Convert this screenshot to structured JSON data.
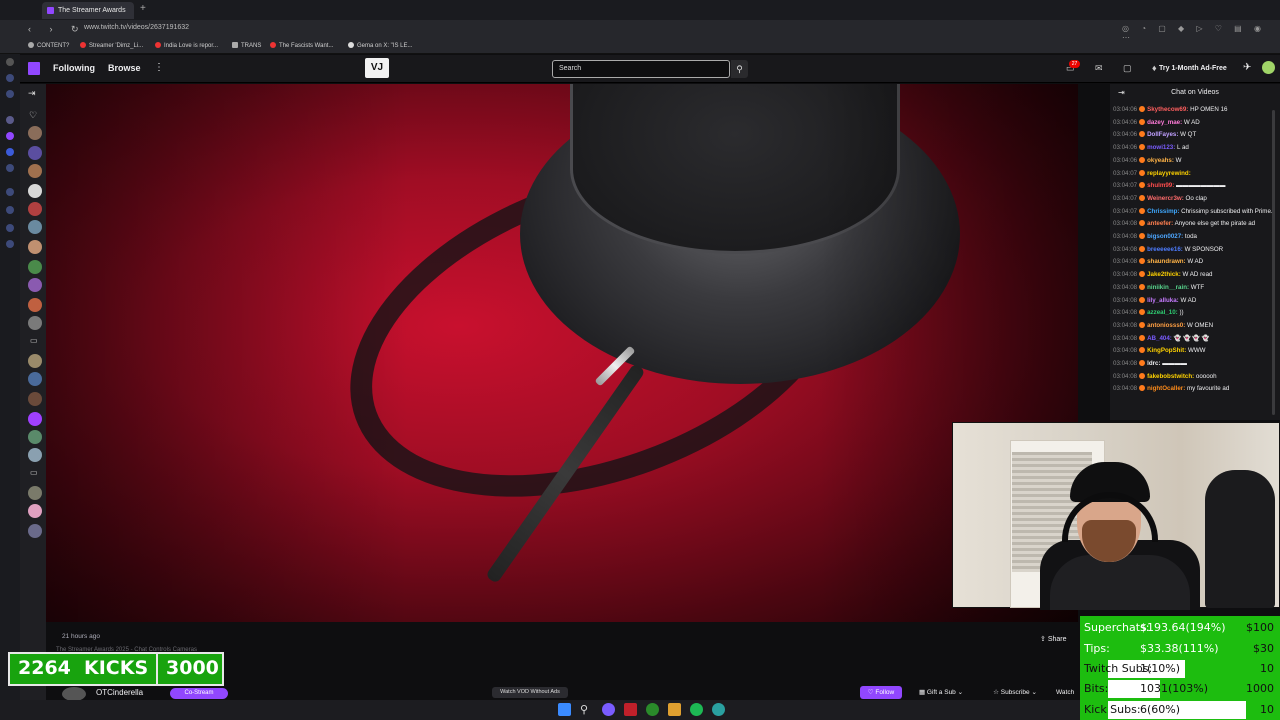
{
  "browser": {
    "tab_title": "The Streamer Awards",
    "new_tab": "+",
    "url": "www.twitch.tv/videos/2637191632",
    "bookmarks": [
      "CONTENT?",
      "Streamer 'Dimz_Li...",
      "India Love is repor...",
      "TRANS",
      "The Fascists Want...",
      "Gema on X: \"IS LE..."
    ]
  },
  "topnav": {
    "following": "Following",
    "browse": "Browse",
    "more": "⋮",
    "logo_text": "VJ",
    "search_placeholder": "Search",
    "notif_count": "27",
    "try_ad_free": "Try 1-Month Ad-Free"
  },
  "chat": {
    "title": "Chat on Videos",
    "messages": [
      {
        "time": "03:04:06",
        "user": "Skythecow69:",
        "text": "HP OMEN 16",
        "color": "#ff5f5f"
      },
      {
        "time": "03:04:06",
        "user": "dazey_mae:",
        "text": "W AD",
        "color": "#ff7ad9"
      },
      {
        "time": "03:04:06",
        "user": "DollFayes:",
        "text": "W QT",
        "color": "#c0a0ff"
      },
      {
        "time": "03:04:06",
        "user": "mowi123:",
        "text": "L ad",
        "color": "#7a5cff"
      },
      {
        "time": "03:04:06",
        "user": "okyeahs:",
        "text": "W",
        "color": "#ffb347"
      },
      {
        "time": "03:04:07",
        "user": "replayyrewind:",
        "text": "",
        "color": "#ffd200"
      },
      {
        "time": "03:04:07",
        "user": "shulm99:",
        "text": "▬▬▬▬▬▬▬▬",
        "color": "#ff4d4d"
      },
      {
        "time": "03:04:07",
        "user": "Weinercr3w:",
        "text": "Oo clap",
        "color": "#ff6b6b"
      },
      {
        "time": "03:04:07",
        "user": "Chrissimp:",
        "text": "Chrissimp subscribed with Prime.",
        "color": "#3fa9ff"
      },
      {
        "time": "03:04:08",
        "user": "anteefer:",
        "text": "Anyone else get the pirate ad",
        "color": "#ff7f50"
      },
      {
        "time": "03:04:08",
        "user": "bigson0027:",
        "text": "toda",
        "color": "#4da6ff"
      },
      {
        "time": "03:04:08",
        "user": "breeeeee16:",
        "text": "W SPONSOR",
        "color": "#4d7cff"
      },
      {
        "time": "03:04:08",
        "user": "shaundrawn:",
        "text": "W AD",
        "color": "#ffb347"
      },
      {
        "time": "03:04:08",
        "user": "Jake2thick:",
        "text": "W AD read",
        "color": "#ffd200"
      },
      {
        "time": "03:04:08",
        "user": "niniikin__rain:",
        "text": "WTF",
        "color": "#58d68d"
      },
      {
        "time": "03:04:08",
        "user": "lily_alluka:",
        "text": "W AD",
        "color": "#c67bff"
      },
      {
        "time": "03:04:08",
        "user": "azzeal_10:",
        "text": "))",
        "color": "#2ecc71"
      },
      {
        "time": "03:04:08",
        "user": "antoniosss0:",
        "text": "W OMEN",
        "color": "#ff9f43"
      },
      {
        "time": "03:04:08",
        "user": "AB_404:",
        "text": "👻 👻 👻 👻",
        "color": "#7a5cff"
      },
      {
        "time": "03:04:08",
        "user": "KingPopShit:",
        "text": "WWW",
        "color": "#ffd200"
      },
      {
        "time": "03:04:08",
        "user": "ldrc:",
        "text": "▬▬▬▬",
        "color": "#efeff1"
      },
      {
        "time": "03:04:08",
        "user": "fakebobstwitch:",
        "text": "oooooh",
        "color": "#ffd200"
      },
      {
        "time": "03:04:08",
        "user": "nightOcaller:",
        "text": "my favourite ad",
        "color": "#ff8c1a"
      }
    ]
  },
  "video": {
    "time_ago": "21 hours ago",
    "title": "The Streamer Awards 2025 - Chat Controls Cameras",
    "share": "Share"
  },
  "channel": {
    "name": "OTCinderella",
    "costream": "Co-Stream",
    "watch_without_ads": "Watch VOD Without Ads",
    "follow": "Follow",
    "gift_sub": "Gift a Sub",
    "subscribe": "Subscribe",
    "watch": "Watch"
  },
  "kicks": {
    "count": "2264",
    "label": "KICKS",
    "goal": "3000"
  },
  "goals": [
    {
      "label": "Superchats:",
      "value": "$193.64(194%)",
      "target": "$100",
      "progress": 1.0
    },
    {
      "label": "Tips:",
      "value": "$33.38(111%)",
      "target": "$30",
      "progress": 1.0
    },
    {
      "label": "Twitch Subs:",
      "value": "1(10%)",
      "target": "10",
      "progress": 0.45
    },
    {
      "label": "Bits:",
      "value": "1031(103%)",
      "target": "1000",
      "progress": 0.3
    },
    {
      "label": "Kick Subs:",
      "value": "6(60%)",
      "target": "10",
      "progress": 0.8
    }
  ],
  "colors": {
    "twitch_purple": "#9147ff",
    "goal_green": "#1dbd0f",
    "kick_green": "#18a30e"
  }
}
